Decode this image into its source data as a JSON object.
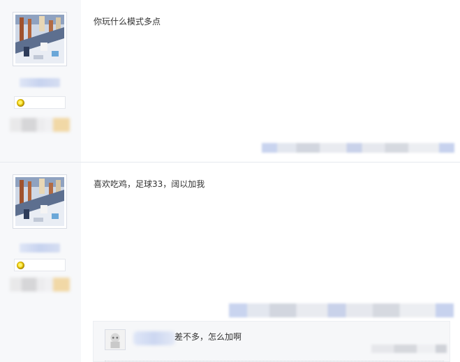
{
  "posts": [
    {
      "content": "你玩什么模式多点",
      "avatar_icon": "game-avatar-icon",
      "badge_icon": "gold-badge-icon"
    },
    {
      "content": "喜欢吃鸡，足球33，阔以加我",
      "avatar_icon": "game-avatar-icon",
      "badge_icon": "gold-badge-icon",
      "replies": [
        {
          "text": "差不多，怎么加啊",
          "avatar_icon": "user-avatar-icon"
        }
      ]
    }
  ],
  "colors": {
    "sidebar_bg": "#f7f8fa",
    "text": "#333333",
    "divider": "#e6e9ef",
    "reply_bg": "#f6f7f9"
  }
}
